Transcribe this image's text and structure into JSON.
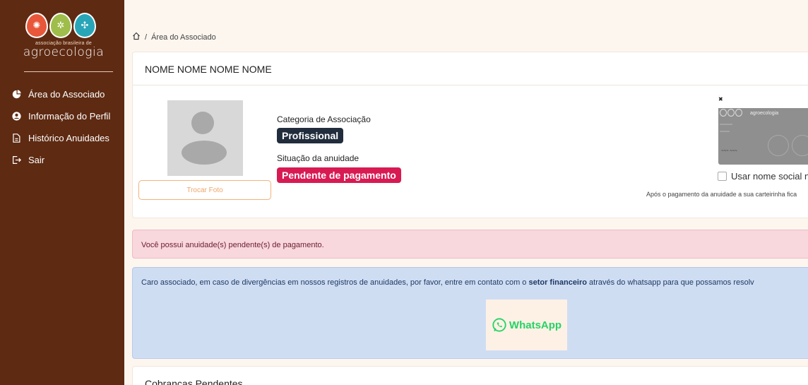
{
  "sidebar": {
    "logo": {
      "small": "associação brasileira de",
      "big": "agroecologia"
    },
    "items": [
      {
        "label": "Área do Associado",
        "icon": "pie-chart-icon"
      },
      {
        "label": "Informação do Perfil",
        "icon": "user-circle-icon"
      },
      {
        "label": "Histórico Anuidades",
        "icon": "file-icon"
      },
      {
        "label": "Sair",
        "icon": "logout-icon"
      }
    ]
  },
  "breadcrumb": {
    "separator": "/",
    "current": "Área do Associado"
  },
  "profile": {
    "name": "NOME NOME NOME NOME",
    "change_photo_label": "Trocar Foto",
    "category_label": "Categoria de Associação",
    "category_value": "Profissional",
    "status_label": "Situação da anuidade",
    "status_value": "Pendente de pagamento",
    "social_name_label": "Usar nome social na ca",
    "card_notice": "Após o pagamento da anuidade a sua carteirinha fica"
  },
  "alerts": {
    "pending": "Você possui anuidade(s) pendente(s) de pagamento.",
    "contact_before": "Caro associado, em caso de divergências em nossos registros de anuidades, por favor, entre em contato com o ",
    "contact_link": "setor financeiro",
    "contact_after": " através do whatsapp para que possamos resolv",
    "whatsapp_label": "WhatsApp"
  },
  "pending_charges": {
    "title": "Cobranças Pendentes"
  },
  "colors": {
    "sidebar": "#5e2a12",
    "badge_category": "#212d3c",
    "badge_pending": "#d81a53",
    "whatsapp": "#25d366"
  }
}
